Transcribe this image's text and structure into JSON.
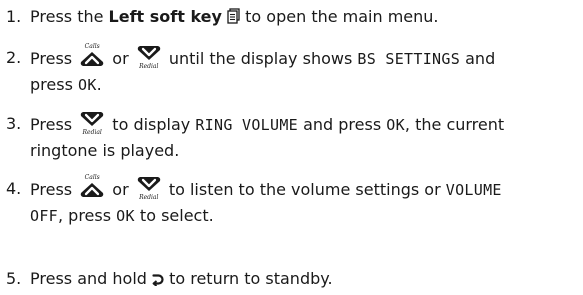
{
  "steps": [
    {
      "number": "1.",
      "t1": "Press the ",
      "bold": "Left soft key",
      "t2": " to open the main menu.",
      "icon": "left-soft-key-icon"
    },
    {
      "number": "2.",
      "t1": "Press ",
      "t2": " or ",
      "t3": " until the display shows ",
      "lcd1": "BS SETTINGS",
      "t4": " and",
      "t5": "press ",
      "lcd2": "OK",
      "t6": "."
    },
    {
      "number": "3.",
      "t1": "Press ",
      "t2": " to display ",
      "lcd1": "RING VOLUME",
      "t3": " and press ",
      "lcd2": "OK",
      "t4": ", the current",
      "t5": "ringtone is played."
    },
    {
      "number": "4.",
      "t1": "Press ",
      "t2": " or ",
      "t3": " to listen to the volume settings or ",
      "lcd1": "VOLUME",
      "lcd2": "OFF",
      "t4": ",  press ",
      "lcd3": "OK",
      "t5": " to select."
    },
    {
      "number": "5.",
      "t1": "Press and hold ",
      "t2": " to return to standby.",
      "icon": "end-call-back-icon"
    }
  ],
  "keys": {
    "up_label": "Calls",
    "down_label": "Redial"
  }
}
